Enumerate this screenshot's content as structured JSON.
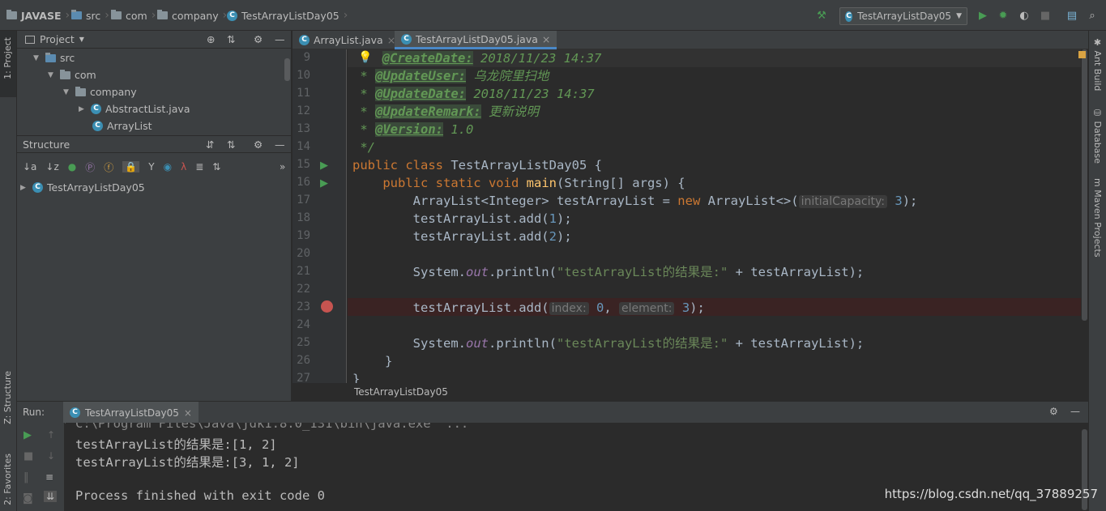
{
  "breadcrumb": {
    "project": "JAVASE",
    "items": [
      "src",
      "com",
      "company",
      "TestArrayListDay05"
    ]
  },
  "run_config": {
    "selected": "TestArrayListDay05"
  },
  "left_tabs": {
    "project": "1: Project",
    "structure": "Z: Structure",
    "favorites": "2: Favorites"
  },
  "right_tabs": {
    "ant": "Ant Build",
    "database": "Database",
    "maven": "Maven Projects"
  },
  "project_panel": {
    "title": "Project",
    "tree": [
      {
        "label": "src"
      },
      {
        "label": "com"
      },
      {
        "label": "company"
      },
      {
        "label": "AbstractList.java"
      },
      {
        "label": "ArrayList"
      }
    ]
  },
  "structure_panel": {
    "title": "Structure",
    "root": "TestArrayListDay05"
  },
  "editor": {
    "tabs": [
      {
        "label": "ArrayList.java",
        "active": false
      },
      {
        "label": "TestArrayListDay05.java",
        "active": true
      }
    ],
    "line_numbers": [
      "9",
      "10",
      "11",
      "12",
      "13",
      "14",
      "15",
      "16",
      "17",
      "18",
      "19",
      "20",
      "21",
      "22",
      "23",
      "24",
      "25",
      "26",
      "27"
    ],
    "breadcrumb": "TestArrayListDay05",
    "code": {
      "l9_tag": "@CreateDate:",
      "l9_val": " 2018/11/23 14:37",
      "l10_tag": "@UpdateUser:",
      "l10_val": " 乌龙院里扫地",
      "l11_tag": "@UpdateDate:",
      "l11_val": " 2018/11/23 14:37",
      "l12_tag": "@UpdateRemark:",
      "l12_val": " 更新说明",
      "l13_tag": "@Version:",
      "l13_val": " 1.0",
      "l14": " */",
      "l15_kw": "public class",
      "l15_name": " TestArrayListDay05 {",
      "l16_kw": "public static void",
      "l16_fn": "main",
      "l16_rest": "(String[] args) {",
      "l17_a": "ArrayList<Integer> testArrayList = ",
      "l17_kw": "new",
      "l17_b": " ArrayList<>(",
      "l17_hint": "initialCapacity:",
      "l17_num": "3",
      "l17_end": ");",
      "l18_a": "testArrayList.add(",
      "l18_num": "1",
      "l18_end": ");",
      "l19_a": "testArrayList.add(",
      "l19_num": "2",
      "l19_end": ");",
      "l21_a": "System.",
      "l21_out": "out",
      "l21_b": ".println(",
      "l21_str": "\"testArrayList的结果是:\"",
      "l21_c": " + testArrayList);",
      "l23_a": "testArrayList.add(",
      "l23_hint1": "index:",
      "l23_num1": "0",
      "l23_hint2": "element:",
      "l23_num2": "3",
      "l23_end": ");",
      "l25_a": "System.",
      "l25_out": "out",
      "l25_b": ".println(",
      "l25_str": "\"testArrayList的结果是:\"",
      "l25_c": " + testArrayList);",
      "l26": "}",
      "l27": "}"
    }
  },
  "run_panel": {
    "label": "Run:",
    "tab": "TestArrayListDay05",
    "output": [
      "C:\\Program Files\\Java\\jdk1.8.0_131\\bin\\java.exe  ...",
      "testArrayList的结果是:[1, 2]",
      "testArrayList的结果是:[3, 1, 2]",
      "",
      "Process finished with exit code 0"
    ]
  },
  "watermark": "https://blog.csdn.net/qq_37889257",
  "colors": {
    "keyword": "#cc7832",
    "string": "#6a8759",
    "number": "#6897bb",
    "comment": "#629755",
    "breakpoint": "#c75450",
    "run_green": "#499c54"
  }
}
